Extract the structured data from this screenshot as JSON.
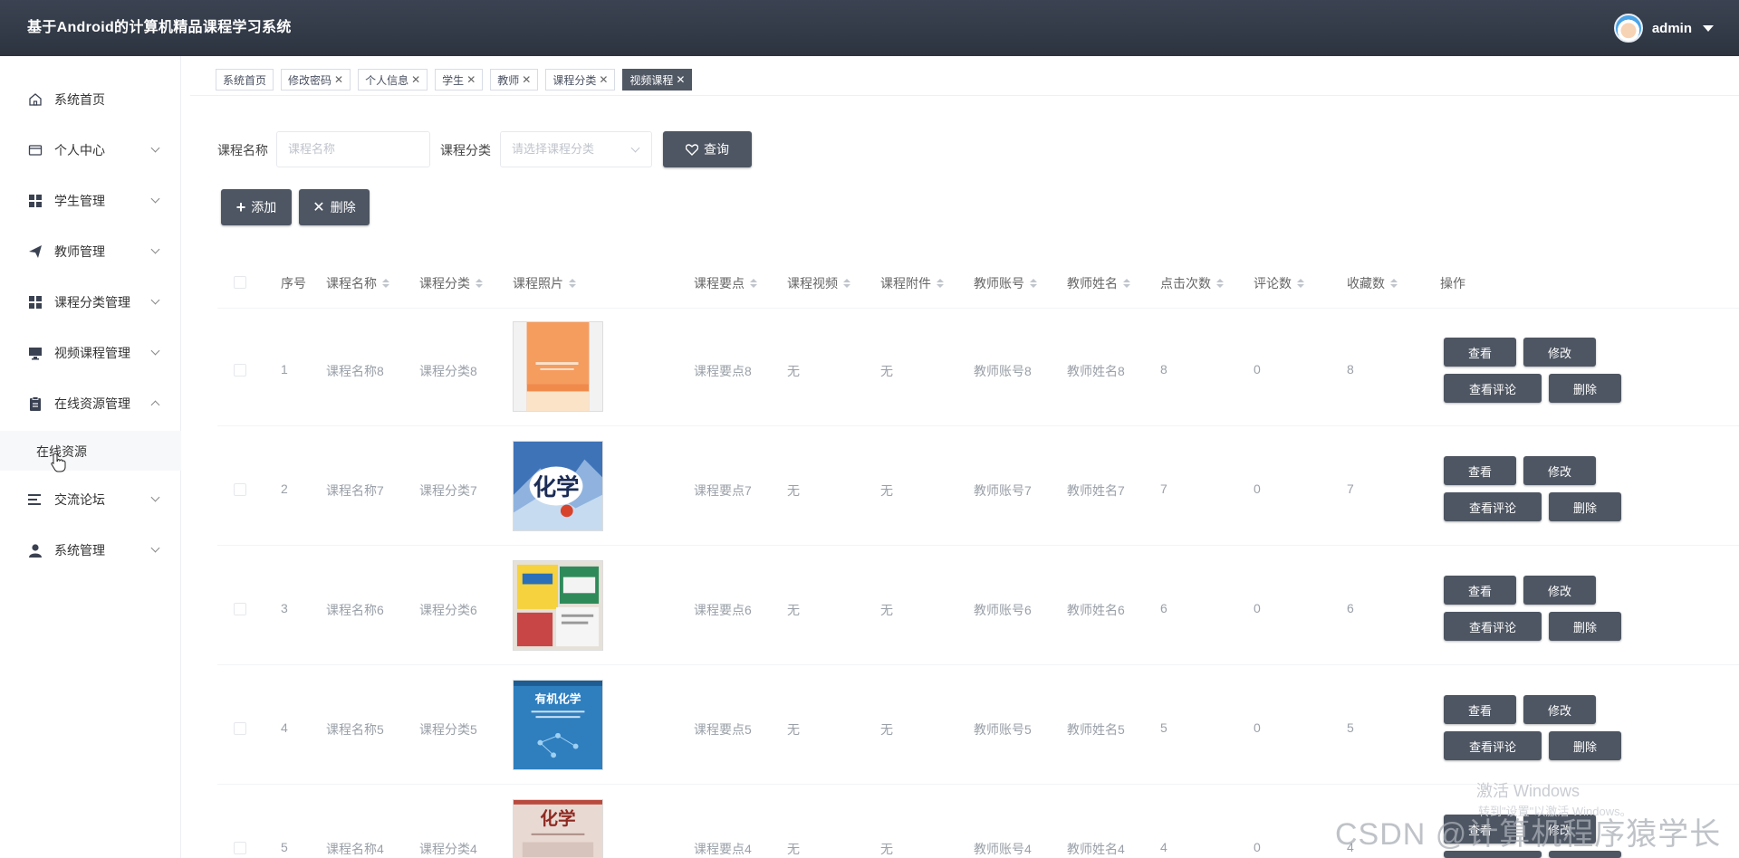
{
  "app": {
    "title": "基于Android的计算机精品课程学习系统",
    "user_name": "admin"
  },
  "sidebar": {
    "items": [
      {
        "label": "系统首页",
        "icon": "home-icon"
      },
      {
        "label": "个人中心",
        "icon": "wallet-icon"
      },
      {
        "label": "学生管理",
        "icon": "grid-icon"
      },
      {
        "label": "教师管理",
        "icon": "send-icon"
      },
      {
        "label": "课程分类管理",
        "icon": "grid-icon"
      },
      {
        "label": "视频课程管理",
        "icon": "monitor-icon"
      },
      {
        "label": "在线资源管理",
        "icon": "clipboard-icon"
      },
      {
        "label": "交流论坛",
        "icon": "list-icon"
      },
      {
        "label": "系统管理",
        "icon": "user-icon"
      }
    ],
    "sub_item": "在线资源"
  },
  "tabs": [
    {
      "label": "系统首页",
      "closable": false
    },
    {
      "label": "修改密码",
      "closable": true
    },
    {
      "label": "个人信息",
      "closable": true
    },
    {
      "label": "学生",
      "closable": true
    },
    {
      "label": "教师",
      "closable": true
    },
    {
      "label": "课程分类",
      "closable": true
    },
    {
      "label": "视频课程",
      "closable": true,
      "active": true
    }
  ],
  "search": {
    "name_label": "课程名称",
    "name_placeholder": "课程名称",
    "category_label": "课程分类",
    "category_placeholder": "请选择课程分类",
    "query_button": "查询"
  },
  "actions": {
    "add": "添加",
    "delete": "删除"
  },
  "table": {
    "headers": [
      "序号",
      "课程名称",
      "课程分类",
      "课程照片",
      "课程要点",
      "课程视频",
      "课程附件",
      "教师账号",
      "教师姓名",
      "点击次数",
      "评论数",
      "收藏数",
      "操作"
    ],
    "rows": [
      {
        "no": "1",
        "name": "课程名称8",
        "category": "课程分类8",
        "points": "课程要点8",
        "video": "无",
        "attachment": "无",
        "teacher_account": "教师账号8",
        "teacher_name": "教师姓名8",
        "clicks": "8",
        "comments": "0",
        "favorites": "8"
      },
      {
        "no": "2",
        "name": "课程名称7",
        "category": "课程分类7",
        "points": "课程要点7",
        "video": "无",
        "attachment": "无",
        "teacher_account": "教师账号7",
        "teacher_name": "教师姓名7",
        "clicks": "7",
        "comments": "0",
        "favorites": "7"
      },
      {
        "no": "3",
        "name": "课程名称6",
        "category": "课程分类6",
        "points": "课程要点6",
        "video": "无",
        "attachment": "无",
        "teacher_account": "教师账号6",
        "teacher_name": "教师姓名6",
        "clicks": "6",
        "comments": "0",
        "favorites": "6"
      },
      {
        "no": "4",
        "name": "课程名称5",
        "category": "课程分类5",
        "points": "课程要点5",
        "video": "无",
        "attachment": "无",
        "teacher_account": "教师账号5",
        "teacher_name": "教师姓名5",
        "clicks": "5",
        "comments": "0",
        "favorites": "5"
      },
      {
        "no": "5",
        "name": "课程名称4",
        "category": "课程分类4",
        "points": "课程要点4",
        "video": "无",
        "attachment": "无",
        "teacher_account": "教师账号4",
        "teacher_name": "教师姓名4",
        "clicks": "4",
        "comments": "0",
        "favorites": "4"
      }
    ],
    "row_buttons": {
      "view": "查看",
      "edit": "修改",
      "view_comments": "查看评论",
      "delete": "删除"
    }
  },
  "watermarks": {
    "activate": "激活 Windows",
    "activate_sub": "转到\"设置\"以激活 Windows。",
    "csdn": "CSDN @计算机程序猿学长"
  },
  "colors": {
    "header_bg": "#333a47",
    "button_bg": "#4e5663",
    "active_tab": "#505864"
  }
}
